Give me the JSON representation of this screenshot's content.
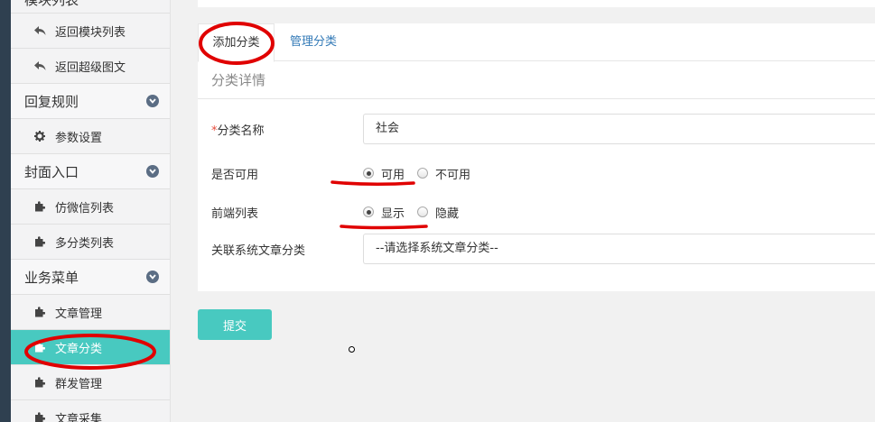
{
  "sidebar": {
    "top_cut": "模块列表",
    "items": [
      {
        "type": "sub",
        "label": "返回模块列表",
        "icon": "reply-icon"
      },
      {
        "type": "sub",
        "label": "返回超级图文",
        "icon": "reply-icon"
      },
      {
        "type": "head",
        "label": "回复规则"
      },
      {
        "type": "sub",
        "label": "参数设置",
        "icon": "gear-icon"
      },
      {
        "type": "head",
        "label": "封面入口"
      },
      {
        "type": "sub",
        "label": "仿微信列表",
        "icon": "puzzle-icon"
      },
      {
        "type": "sub",
        "label": "多分类列表",
        "icon": "puzzle-icon"
      },
      {
        "type": "head",
        "label": "业务菜单"
      },
      {
        "type": "sub",
        "label": "文章管理",
        "icon": "puzzle-icon"
      },
      {
        "type": "sub",
        "label": "文章分类",
        "icon": "puzzle-icon",
        "active": true
      },
      {
        "type": "sub",
        "label": "群发管理",
        "icon": "puzzle-icon"
      },
      {
        "type": "sub",
        "label": "文章采集",
        "icon": "puzzle-icon"
      }
    ]
  },
  "tabs": [
    "添加分类",
    "管理分类"
  ],
  "panel_title": "分类详情",
  "form": {
    "name_required": "*",
    "name_label": "分类名称",
    "name_value": "社会",
    "enabled_label": "是否可用",
    "enabled_options": [
      "可用",
      "不可用"
    ],
    "enabled_selected": "可用",
    "front_label": "前端列表",
    "front_options": [
      "显示",
      "隐藏"
    ],
    "front_selected": "显示",
    "link_label": "关联系统文章分类",
    "link_value": "--请选择系统文章分类--"
  },
  "submit_label": "提交",
  "colors": {
    "accent": "#48c9c0",
    "link": "#337ab7",
    "annotation": "#e00000",
    "sidebar_dark": "#2f4050"
  }
}
